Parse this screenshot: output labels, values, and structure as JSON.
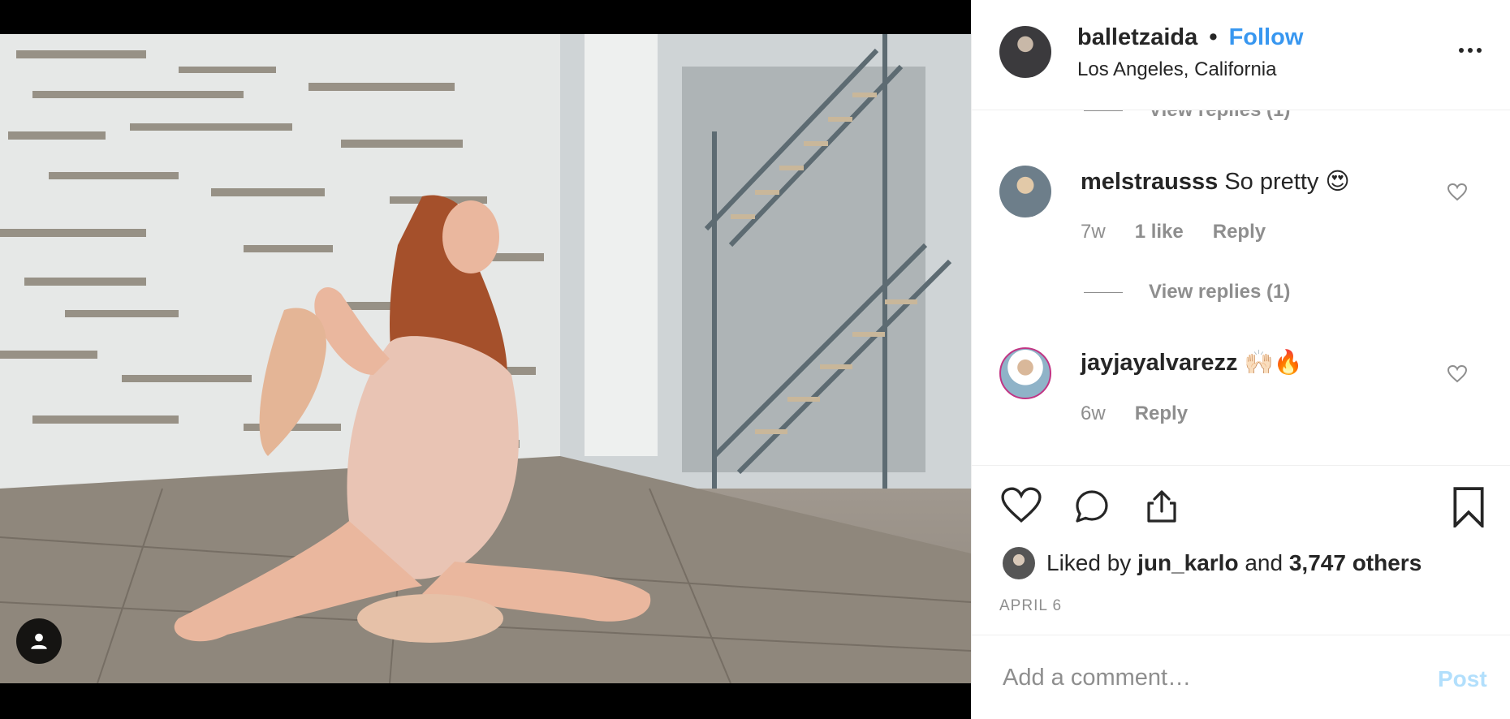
{
  "post": {
    "author": "balletzaida",
    "separator": "•",
    "follow_label": "Follow",
    "location": "Los Angeles, California",
    "more_icon": "more-horizontal-icon"
  },
  "comments": {
    "top_view_replies": "View replies (1)",
    "items": [
      {
        "username": "melstrausss",
        "text": "So pretty 😍",
        "age": "7w",
        "likes": "1 like",
        "reply_label": "Reply",
        "view_replies": "View replies (1)"
      },
      {
        "username": "jayjayalvarezz",
        "text": "🙌🏻🔥",
        "age": "6w",
        "reply_label": "Reply"
      }
    ]
  },
  "actions": {
    "like_icon": "heart-icon",
    "comment_icon": "comment-icon",
    "share_icon": "share-icon",
    "save_icon": "bookmark-icon"
  },
  "likes": {
    "prefix": "Liked by",
    "user": "jun_karlo",
    "conjunction": "and",
    "others": "3,747 others"
  },
  "date": "APRIL 6",
  "add_comment": {
    "placeholder": "Add a comment…",
    "post_label": "Post"
  },
  "colors": {
    "link_blue": "#3897f0",
    "post_disabled": "#b2dffc",
    "muted_text": "#8e8e8e",
    "primary_text": "#262626"
  }
}
